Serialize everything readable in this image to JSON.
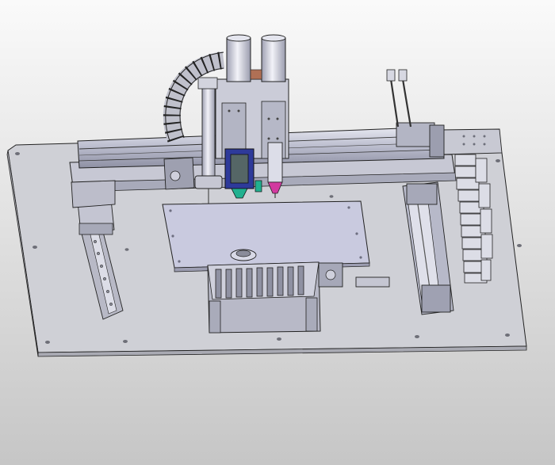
{
  "viewport": {
    "background_top": "#fafafa",
    "background_bottom": "#c6c6c6"
  },
  "model": {
    "base_plate_color": "#cfd0d6",
    "metal_color": "#d8d9e6",
    "dark_metal_color": "#8a8c9a",
    "bed_color": "#c9cadf",
    "line_color": "#222222",
    "blue_head_color": "#2e3a9a",
    "pink_nozzle_color": "#d23aa0",
    "green_tip_color": "#21b090",
    "brown_accent_color": "#b07055"
  }
}
